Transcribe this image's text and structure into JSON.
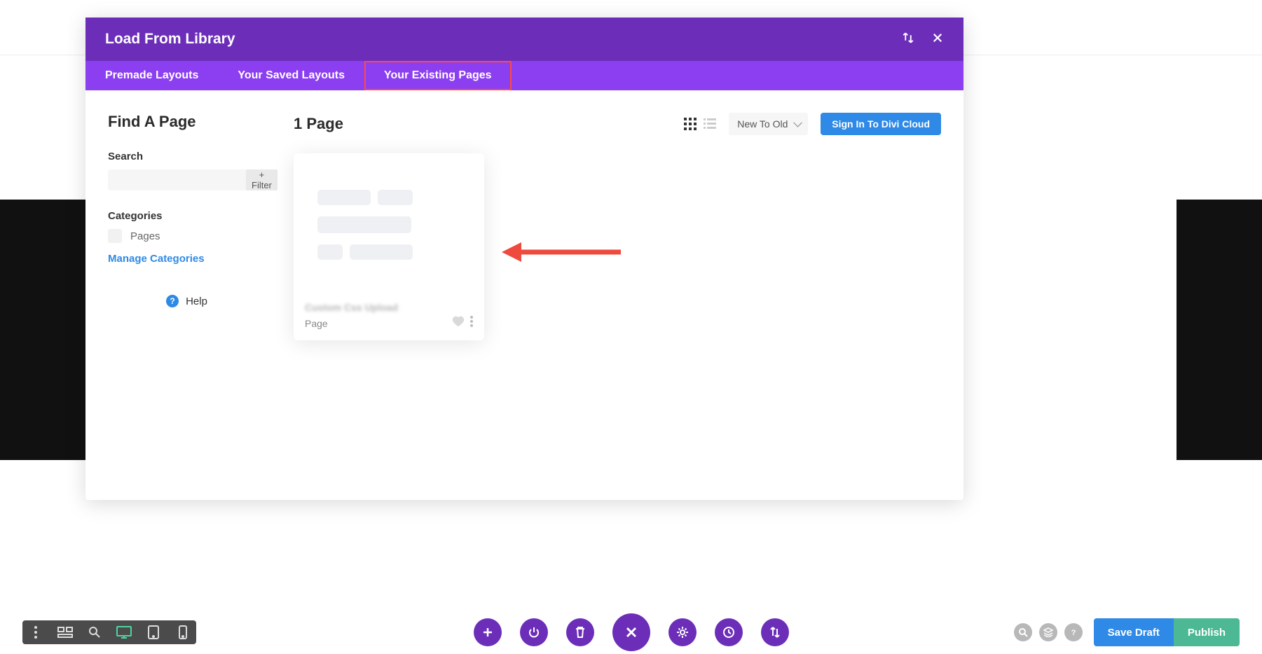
{
  "modal": {
    "title": "Load From Library",
    "tabs": [
      {
        "label": "Premade Layouts"
      },
      {
        "label": "Your Saved Layouts"
      },
      {
        "label": "Your Existing Pages"
      }
    ],
    "sidebar": {
      "find_title": "Find A Page",
      "search_label": "Search",
      "filter_label": "+ Filter",
      "categories_label": "Categories",
      "category_pages": "Pages",
      "manage_categories": "Manage Categories",
      "help": "Help"
    },
    "content": {
      "count_title": "1 Page",
      "sort_value": "New To Old",
      "signin_label": "Sign In To Divi Cloud",
      "card": {
        "title_blur": "Custom Css Upload",
        "subtitle": "Page"
      }
    }
  },
  "bottom": {
    "save_draft": "Save Draft",
    "publish": "Publish"
  }
}
